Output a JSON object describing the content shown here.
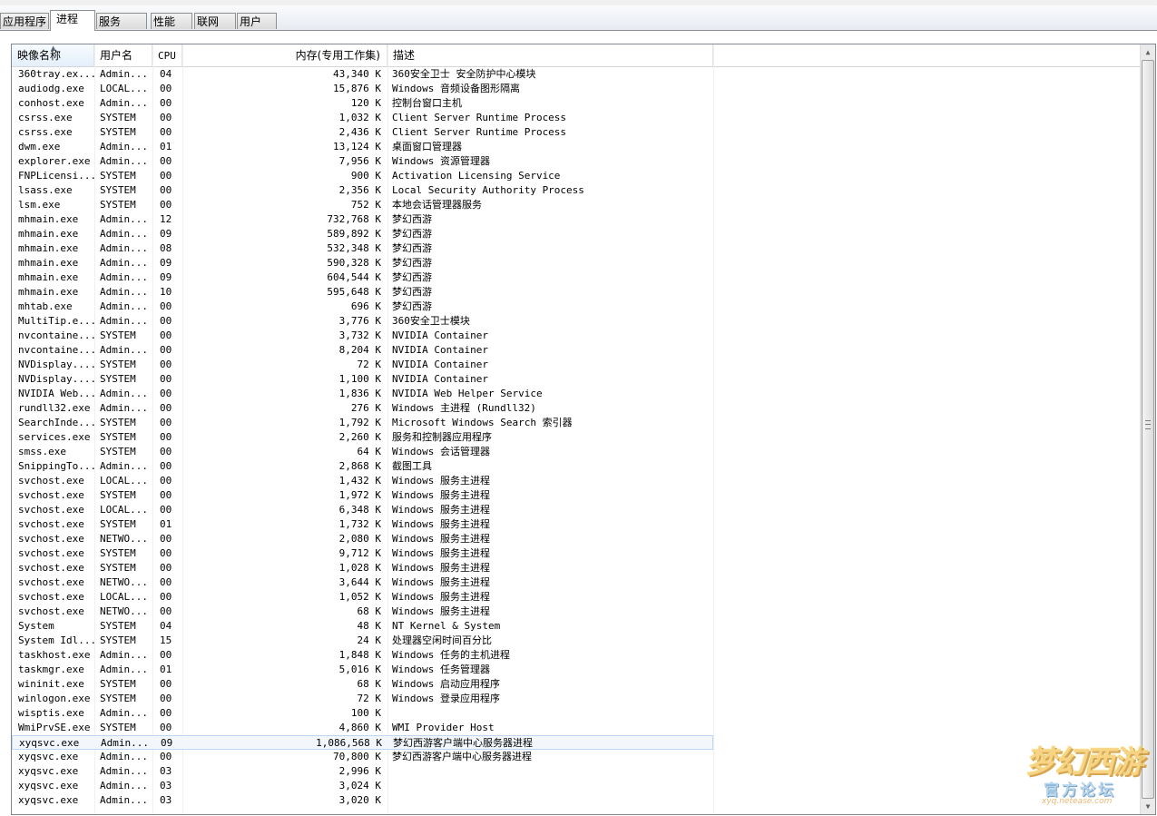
{
  "tabs": [
    {
      "label": "应用程序"
    },
    {
      "label": "进程"
    },
    {
      "label": "服务"
    },
    {
      "label": "性能"
    },
    {
      "label": "联网"
    },
    {
      "label": "用户"
    }
  ],
  "columns": {
    "name": "映像名称",
    "user": "用户名",
    "cpu": "CPU",
    "mem": "内存(专用工作集)",
    "desc": "描述"
  },
  "rows": [
    {
      "name": "360tray.ex...",
      "user": "Admin...",
      "cpu": "04",
      "mem": "43,340 K",
      "desc": "360安全卫士 安全防护中心模块"
    },
    {
      "name": "audiodg.exe",
      "user": "LOCAL...",
      "cpu": "00",
      "mem": "15,876 K",
      "desc": "Windows 音频设备图形隔离"
    },
    {
      "name": "conhost.exe",
      "user": "Admin...",
      "cpu": "00",
      "mem": "120 K",
      "desc": "控制台窗口主机"
    },
    {
      "name": "csrss.exe",
      "user": "SYSTEM",
      "cpu": "00",
      "mem": "1,032 K",
      "desc": "Client Server Runtime Process"
    },
    {
      "name": "csrss.exe",
      "user": "SYSTEM",
      "cpu": "00",
      "mem": "2,436 K",
      "desc": "Client Server Runtime Process"
    },
    {
      "name": "dwm.exe",
      "user": "Admin...",
      "cpu": "01",
      "mem": "13,124 K",
      "desc": "桌面窗口管理器"
    },
    {
      "name": "explorer.exe",
      "user": "Admin...",
      "cpu": "00",
      "mem": "7,956 K",
      "desc": "Windows 资源管理器"
    },
    {
      "name": "FNPLicensi...",
      "user": "SYSTEM",
      "cpu": "00",
      "mem": "900 K",
      "desc": "Activation Licensing Service"
    },
    {
      "name": "lsass.exe",
      "user": "SYSTEM",
      "cpu": "00",
      "mem": "2,356 K",
      "desc": "Local Security Authority Process"
    },
    {
      "name": "lsm.exe",
      "user": "SYSTEM",
      "cpu": "00",
      "mem": "752 K",
      "desc": "本地会话管理器服务"
    },
    {
      "name": "mhmain.exe",
      "user": "Admin...",
      "cpu": "12",
      "mem": "732,768 K",
      "desc": "梦幻西游"
    },
    {
      "name": "mhmain.exe",
      "user": "Admin...",
      "cpu": "09",
      "mem": "589,892 K",
      "desc": "梦幻西游"
    },
    {
      "name": "mhmain.exe",
      "user": "Admin...",
      "cpu": "08",
      "mem": "532,348 K",
      "desc": "梦幻西游"
    },
    {
      "name": "mhmain.exe",
      "user": "Admin...",
      "cpu": "09",
      "mem": "590,328 K",
      "desc": "梦幻西游"
    },
    {
      "name": "mhmain.exe",
      "user": "Admin...",
      "cpu": "09",
      "mem": "604,544 K",
      "desc": "梦幻西游"
    },
    {
      "name": "mhmain.exe",
      "user": "Admin...",
      "cpu": "10",
      "mem": "595,648 K",
      "desc": "梦幻西游"
    },
    {
      "name": "mhtab.exe",
      "user": "Admin...",
      "cpu": "00",
      "mem": "696 K",
      "desc": "梦幻西游"
    },
    {
      "name": "MultiTip.e...",
      "user": "Admin...",
      "cpu": "00",
      "mem": "3,776 K",
      "desc": "360安全卫士模块"
    },
    {
      "name": "nvcontaine...",
      "user": "SYSTEM",
      "cpu": "00",
      "mem": "3,732 K",
      "desc": "NVIDIA Container"
    },
    {
      "name": "nvcontaine...",
      "user": "Admin...",
      "cpu": "00",
      "mem": "8,204 K",
      "desc": "NVIDIA Container"
    },
    {
      "name": "NVDisplay....",
      "user": "SYSTEM",
      "cpu": "00",
      "mem": "72 K",
      "desc": "NVIDIA Container"
    },
    {
      "name": "NVDisplay....",
      "user": "SYSTEM",
      "cpu": "00",
      "mem": "1,100 K",
      "desc": "NVIDIA Container"
    },
    {
      "name": "NVIDIA Web...",
      "user": "Admin...",
      "cpu": "00",
      "mem": "1,836 K",
      "desc": "NVIDIA Web Helper Service"
    },
    {
      "name": "rundll32.exe",
      "user": "Admin...",
      "cpu": "00",
      "mem": "276 K",
      "desc": "Windows 主进程 (Rundll32)"
    },
    {
      "name": "SearchInde...",
      "user": "SYSTEM",
      "cpu": "00",
      "mem": "1,792 K",
      "desc": "Microsoft Windows Search 索引器"
    },
    {
      "name": "services.exe",
      "user": "SYSTEM",
      "cpu": "00",
      "mem": "2,260 K",
      "desc": "服务和控制器应用程序"
    },
    {
      "name": "smss.exe",
      "user": "SYSTEM",
      "cpu": "00",
      "mem": "64 K",
      "desc": "Windows 会话管理器"
    },
    {
      "name": "SnippingTo...",
      "user": "Admin...",
      "cpu": "00",
      "mem": "2,868 K",
      "desc": "截图工具"
    },
    {
      "name": "svchost.exe",
      "user": "LOCAL...",
      "cpu": "00",
      "mem": "1,432 K",
      "desc": "Windows 服务主进程"
    },
    {
      "name": "svchost.exe",
      "user": "SYSTEM",
      "cpu": "00",
      "mem": "1,972 K",
      "desc": "Windows 服务主进程"
    },
    {
      "name": "svchost.exe",
      "user": "LOCAL...",
      "cpu": "00",
      "mem": "6,348 K",
      "desc": "Windows 服务主进程"
    },
    {
      "name": "svchost.exe",
      "user": "SYSTEM",
      "cpu": "01",
      "mem": "1,732 K",
      "desc": "Windows 服务主进程"
    },
    {
      "name": "svchost.exe",
      "user": "NETWO...",
      "cpu": "00",
      "mem": "2,080 K",
      "desc": "Windows 服务主进程"
    },
    {
      "name": "svchost.exe",
      "user": "SYSTEM",
      "cpu": "00",
      "mem": "9,712 K",
      "desc": "Windows 服务主进程"
    },
    {
      "name": "svchost.exe",
      "user": "SYSTEM",
      "cpu": "00",
      "mem": "1,028 K",
      "desc": "Windows 服务主进程"
    },
    {
      "name": "svchost.exe",
      "user": "NETWO...",
      "cpu": "00",
      "mem": "3,644 K",
      "desc": "Windows 服务主进程"
    },
    {
      "name": "svchost.exe",
      "user": "LOCAL...",
      "cpu": "00",
      "mem": "1,052 K",
      "desc": "Windows 服务主进程"
    },
    {
      "name": "svchost.exe",
      "user": "NETWO...",
      "cpu": "00",
      "mem": "68 K",
      "desc": "Windows 服务主进程"
    },
    {
      "name": "System",
      "user": "SYSTEM",
      "cpu": "04",
      "mem": "48 K",
      "desc": "NT Kernel & System"
    },
    {
      "name": "System Idl...",
      "user": "SYSTEM",
      "cpu": "15",
      "mem": "24 K",
      "desc": "处理器空闲时间百分比"
    },
    {
      "name": "taskhost.exe",
      "user": "Admin...",
      "cpu": "00",
      "mem": "1,848 K",
      "desc": "Windows 任务的主机进程"
    },
    {
      "name": "taskmgr.exe",
      "user": "Admin...",
      "cpu": "01",
      "mem": "5,016 K",
      "desc": "Windows 任务管理器"
    },
    {
      "name": "wininit.exe",
      "user": "SYSTEM",
      "cpu": "00",
      "mem": "68 K",
      "desc": "Windows 启动应用程序"
    },
    {
      "name": "winlogon.exe",
      "user": "SYSTEM",
      "cpu": "00",
      "mem": "72 K",
      "desc": "Windows 登录应用程序"
    },
    {
      "name": "wisptis.exe",
      "user": "Admin...",
      "cpu": "00",
      "mem": "100 K",
      "desc": ""
    },
    {
      "name": "WmiPrvSE.exe",
      "user": "SYSTEM",
      "cpu": "00",
      "mem": "4,860 K",
      "desc": "WMI Provider Host"
    },
    {
      "name": "xyqsvc.exe",
      "user": "Admin...",
      "cpu": "09",
      "mem": "1,086,568 K",
      "desc": "梦幻西游客户端中心服务器进程",
      "selected": true
    },
    {
      "name": "xyqsvc.exe",
      "user": "Admin...",
      "cpu": "00",
      "mem": "70,800 K",
      "desc": "梦幻西游客户端中心服务器进程"
    },
    {
      "name": "xyqsvc.exe",
      "user": "Admin...",
      "cpu": "03",
      "mem": "2,996 K",
      "desc": ""
    },
    {
      "name": "xyqsvc.exe",
      "user": "Admin...",
      "cpu": "03",
      "mem": "3,024 K",
      "desc": ""
    },
    {
      "name": "xyqsvc.exe",
      "user": "Admin...",
      "cpu": "03",
      "mem": "3,020 K",
      "desc": ""
    }
  ],
  "watermark": {
    "title": "梦幻西游",
    "subtitle": "官方论坛",
    "url": "xyq.netease.com"
  },
  "colors": {
    "tab_border": "#8e8f8f",
    "selected_row_border": "#bcd7f4",
    "watermark_gold": "#f3c65a"
  }
}
